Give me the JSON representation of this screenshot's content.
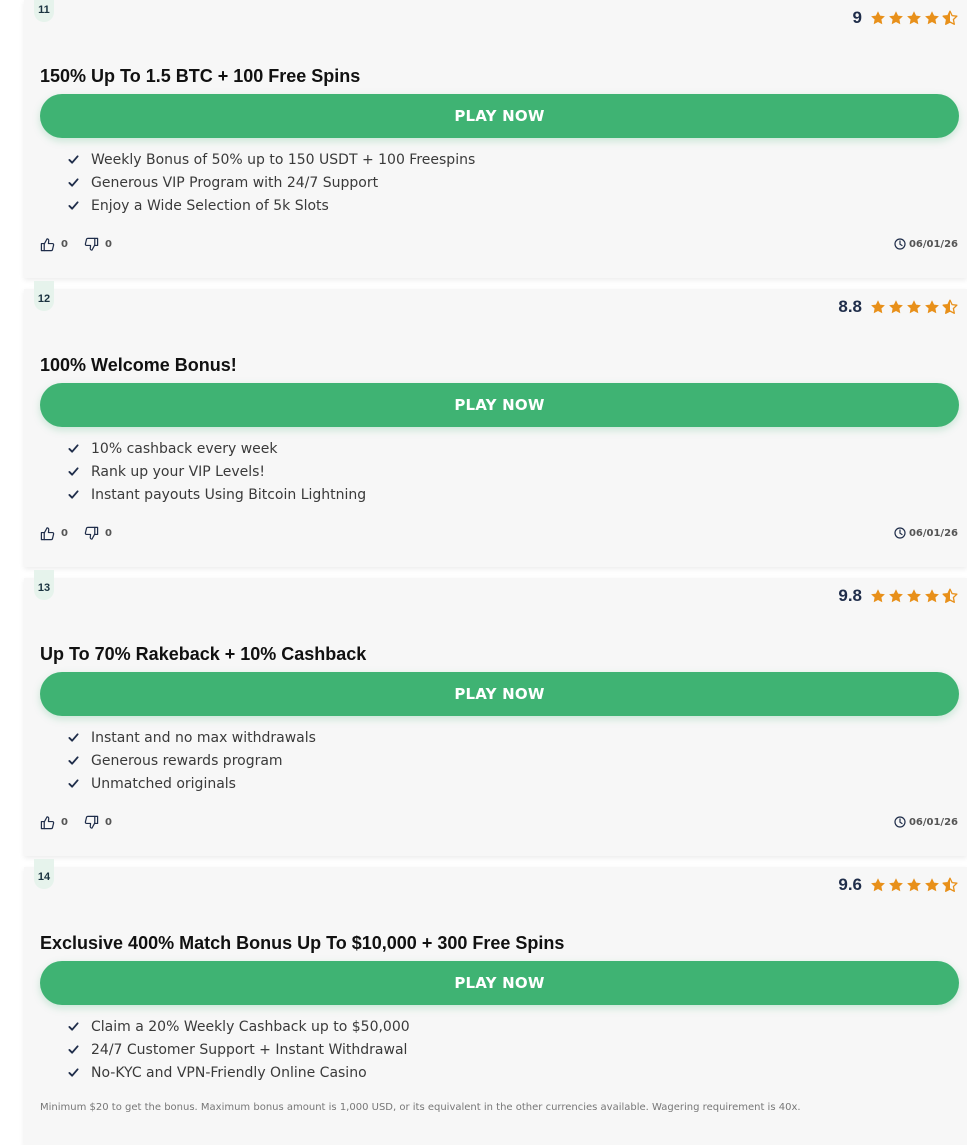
{
  "offers": [
    {
      "rank": "11",
      "score": "9",
      "stars": 4.5,
      "title": "150% Up To 1.5 BTC + 100 Free Spins",
      "cta": "PLAY NOW",
      "features": [
        "Weekly Bonus of 50% up to 150 USDT + 100 Freespins",
        "Generous VIP Program with 24/7 Support",
        "Enjoy a Wide Selection of 5k Slots"
      ],
      "likes": "0",
      "dislikes": "0",
      "date": "06/01/26"
    },
    {
      "rank": "12",
      "score": "8.8",
      "stars": 4.5,
      "title": "100% Welcome Bonus!",
      "cta": "PLAY NOW",
      "features": [
        "10% cashback every week",
        "Rank up your VIP Levels!",
        "Instant payouts Using Bitcoin Lightning"
      ],
      "likes": "0",
      "dislikes": "0",
      "date": "06/01/26"
    },
    {
      "rank": "13",
      "score": "9.8",
      "stars": 4.5,
      "title": "Up To 70% Rakeback + 10% Cashback",
      "cta": "PLAY NOW",
      "features": [
        "Instant and no max withdrawals",
        "Generous rewards program",
        "Unmatched originals"
      ],
      "likes": "0",
      "dislikes": "0",
      "date": "06/01/26"
    },
    {
      "rank": "14",
      "score": "9.6",
      "stars": 4.5,
      "title": "Exclusive 400% Match Bonus Up To $10,000 + 300 Free Spins",
      "cta": "PLAY NOW",
      "features": [
        "Claim a 20% Weekly Cashback up to $50,000",
        "24/7 Customer Support + Instant Withdrawal",
        "No-KYC and VPN-Friendly Online Casino"
      ],
      "fine_print": "Minimum $20 to get the bonus. Maximum bonus amount is 1,000 USD, or its equivalent in the other currencies available. Wagering requirement is 40x."
    }
  ],
  "colors": {
    "accent": "#3fb373",
    "star": "#e8901a",
    "score": "#1f2d4a",
    "card": "#f7f7f7"
  },
  "icons": {
    "star": "star-icon",
    "half_star": "star-half-icon",
    "check": "check-icon",
    "like": "thumbs-up-icon",
    "dislike": "thumbs-down-icon",
    "date": "clock-icon"
  }
}
